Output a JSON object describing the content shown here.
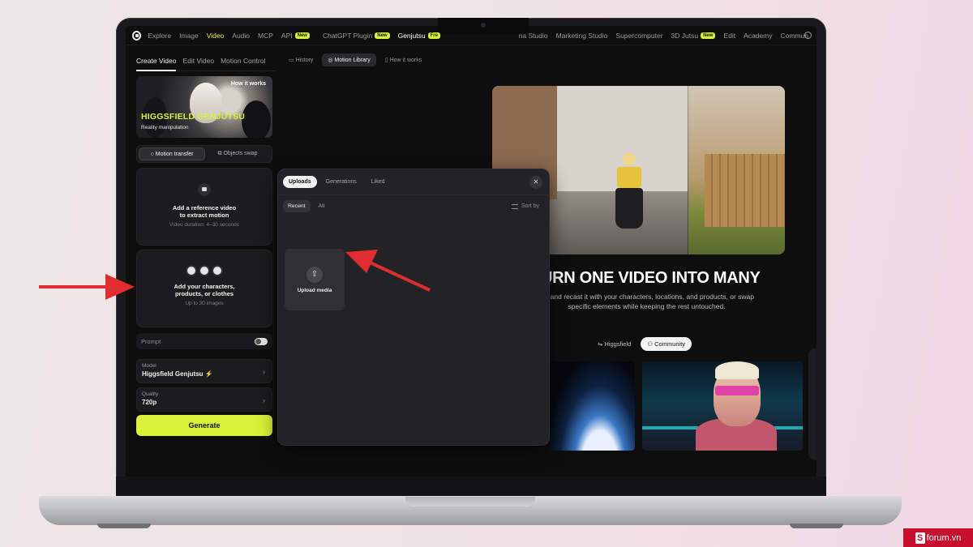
{
  "nav": {
    "items": [
      {
        "label": "Explore"
      },
      {
        "label": "Image"
      },
      {
        "label": "Video",
        "active": true
      },
      {
        "label": "Audio"
      },
      {
        "label": "MCP"
      },
      {
        "label": "API",
        "badge": "New"
      },
      {
        "label": "ChatGPT Plugin",
        "badge": "New"
      },
      {
        "label": "Genjutsu",
        "badge": "Fre",
        "highlight": true
      }
    ],
    "items_right": [
      {
        "label": "na Studio"
      },
      {
        "label": "Marketing Studio"
      },
      {
        "label": "Supercomputer"
      },
      {
        "label": "3D Jutsu",
        "badge": "New"
      },
      {
        "label": "Edit"
      },
      {
        "label": "Academy"
      },
      {
        "label": "Commun"
      }
    ]
  },
  "left": {
    "tabs": [
      "Create Video",
      "Edit Video",
      "Motion Control"
    ],
    "hero": {
      "how": "How it works",
      "title": "HIGGSFIELD GENJUTSU",
      "subtitle": "Reality manipulation"
    },
    "modes": [
      "Motion transfer",
      "Objects swap"
    ],
    "ref_card": {
      "title_1": "Add a reference video",
      "title_2": "to extract motion",
      "hint": "Video duration: 4–30 seconds"
    },
    "char_card": {
      "title_1": "Add your characters,",
      "title_2": "products, or clothes",
      "hint": "Up to 30 images"
    },
    "prompt": "Prompt",
    "model": {
      "label": "Model",
      "value": "Higgsfield Genjutsu"
    },
    "quality": {
      "label": "Quality",
      "value": "720p"
    },
    "generate": "Generate"
  },
  "main": {
    "tabs": [
      "History",
      "Motion Library",
      "How it works"
    ],
    "headline": "URN ONE VIDEO INTO MANY",
    "subline_1": "ion and recast it with your characters, locations, and products, or swap",
    "subline_2": "specific elements while keeping the rest untouched.",
    "pills": [
      "Higgsfield",
      "Community"
    ]
  },
  "modal": {
    "tabs": [
      "Uploads",
      "Generations",
      "Liked"
    ],
    "close": "✕",
    "filters": [
      "Recent",
      "All"
    ],
    "sort": "Sort by",
    "upload_label": "Upload media"
  },
  "watermark": {
    "s": "S",
    "text": "forum.vn"
  },
  "colors": {
    "accent": "#d7f33a",
    "arrow": "#e02d2f",
    "panel": "#1c1c1e"
  }
}
